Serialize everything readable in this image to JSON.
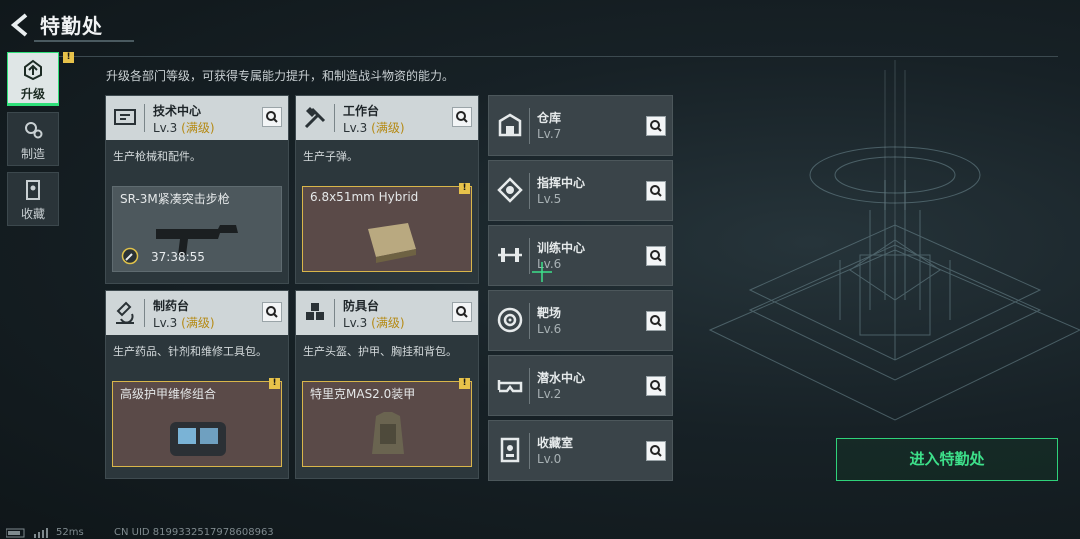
{
  "header": {
    "title": "特勤处"
  },
  "nav": [
    {
      "label": "升级",
      "icon": "upgrade-icon",
      "active": true,
      "badge": "!"
    },
    {
      "label": "制造",
      "icon": "gears-icon",
      "active": false
    },
    {
      "label": "收藏",
      "icon": "collection-icon",
      "active": false
    }
  ],
  "description": "升级各部门等级，可获得专属能力提升，和制造战斗物资的能力。",
  "big_cards": [
    {
      "name": "技术中心",
      "level": "Lv.3",
      "max": "(满级)",
      "desc": "生产枪械和配件。",
      "icon": "tech-center-icon",
      "product": {
        "name": "SR-3M紧凑突击步枪",
        "timer": "37:38:55",
        "style": "gray"
      }
    },
    {
      "name": "工作台",
      "level": "Lv.3",
      "max": "(满级)",
      "desc": "生产子弹。",
      "icon": "workbench-icon",
      "product": {
        "name": "6.8x51mm Hybrid",
        "badge": "!",
        "style": "brown"
      }
    },
    {
      "name": "制药台",
      "level": "Lv.3",
      "max": "(满级)",
      "desc": "生产药品、针剂和维修工具包。",
      "icon": "pharmacy-icon",
      "product": {
        "name": "高级护甲维修组合",
        "badge": "!",
        "style": "brown"
      }
    },
    {
      "name": "防具台",
      "level": "Lv.3",
      "max": "(满级)",
      "desc": "生产头盔、护甲、胸挂和背包。",
      "icon": "armor-bench-icon",
      "product": {
        "name": "特里克MAS2.0装甲",
        "badge": "!",
        "style": "brown"
      }
    }
  ],
  "small_cards": [
    {
      "name": "仓库",
      "level": "Lv.7",
      "icon": "warehouse-icon"
    },
    {
      "name": "指挥中心",
      "level": "Lv.5",
      "icon": "command-center-icon"
    },
    {
      "name": "训练中心",
      "level": "Lv.6",
      "icon": "training-center-icon"
    },
    {
      "name": "靶场",
      "level": "Lv.6",
      "icon": "shooting-range-icon"
    },
    {
      "name": "潜水中心",
      "level": "Lv.2",
      "icon": "diving-center-icon"
    },
    {
      "name": "收藏室",
      "level": "Lv.0",
      "icon": "collection-room-icon"
    }
  ],
  "enter_button": "进入特勤处",
  "footer": {
    "ping": "52ms",
    "uid": "CN UID 8199332517978608963"
  },
  "colors": {
    "accent_green": "#2fe07a",
    "max_gold": "#b58a14",
    "badge_yellow": "#e7c24a"
  }
}
